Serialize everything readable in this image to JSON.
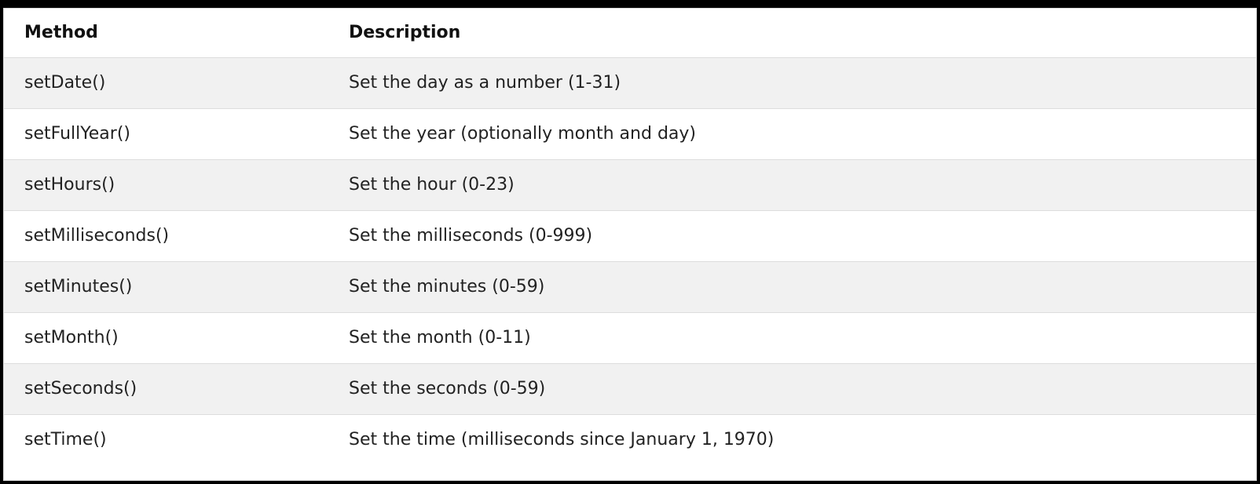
{
  "table": {
    "headers": {
      "method": "Method",
      "description": "Description"
    },
    "rows": [
      {
        "method": "setDate()",
        "description": "Set the day as a number (1-31)"
      },
      {
        "method": "setFullYear()",
        "description": "Set the year (optionally month and day)"
      },
      {
        "method": "setHours()",
        "description": "Set the hour (0-23)"
      },
      {
        "method": "setMilliseconds()",
        "description": "Set the milliseconds (0-999)"
      },
      {
        "method": "setMinutes()",
        "description": "Set the minutes (0-59)"
      },
      {
        "method": "setMonth()",
        "description": "Set the month (0-11)"
      },
      {
        "method": "setSeconds()",
        "description": "Set the seconds (0-59)"
      },
      {
        "method": "setTime()",
        "description": "Set the time (milliseconds since January 1, 1970)"
      }
    ]
  }
}
